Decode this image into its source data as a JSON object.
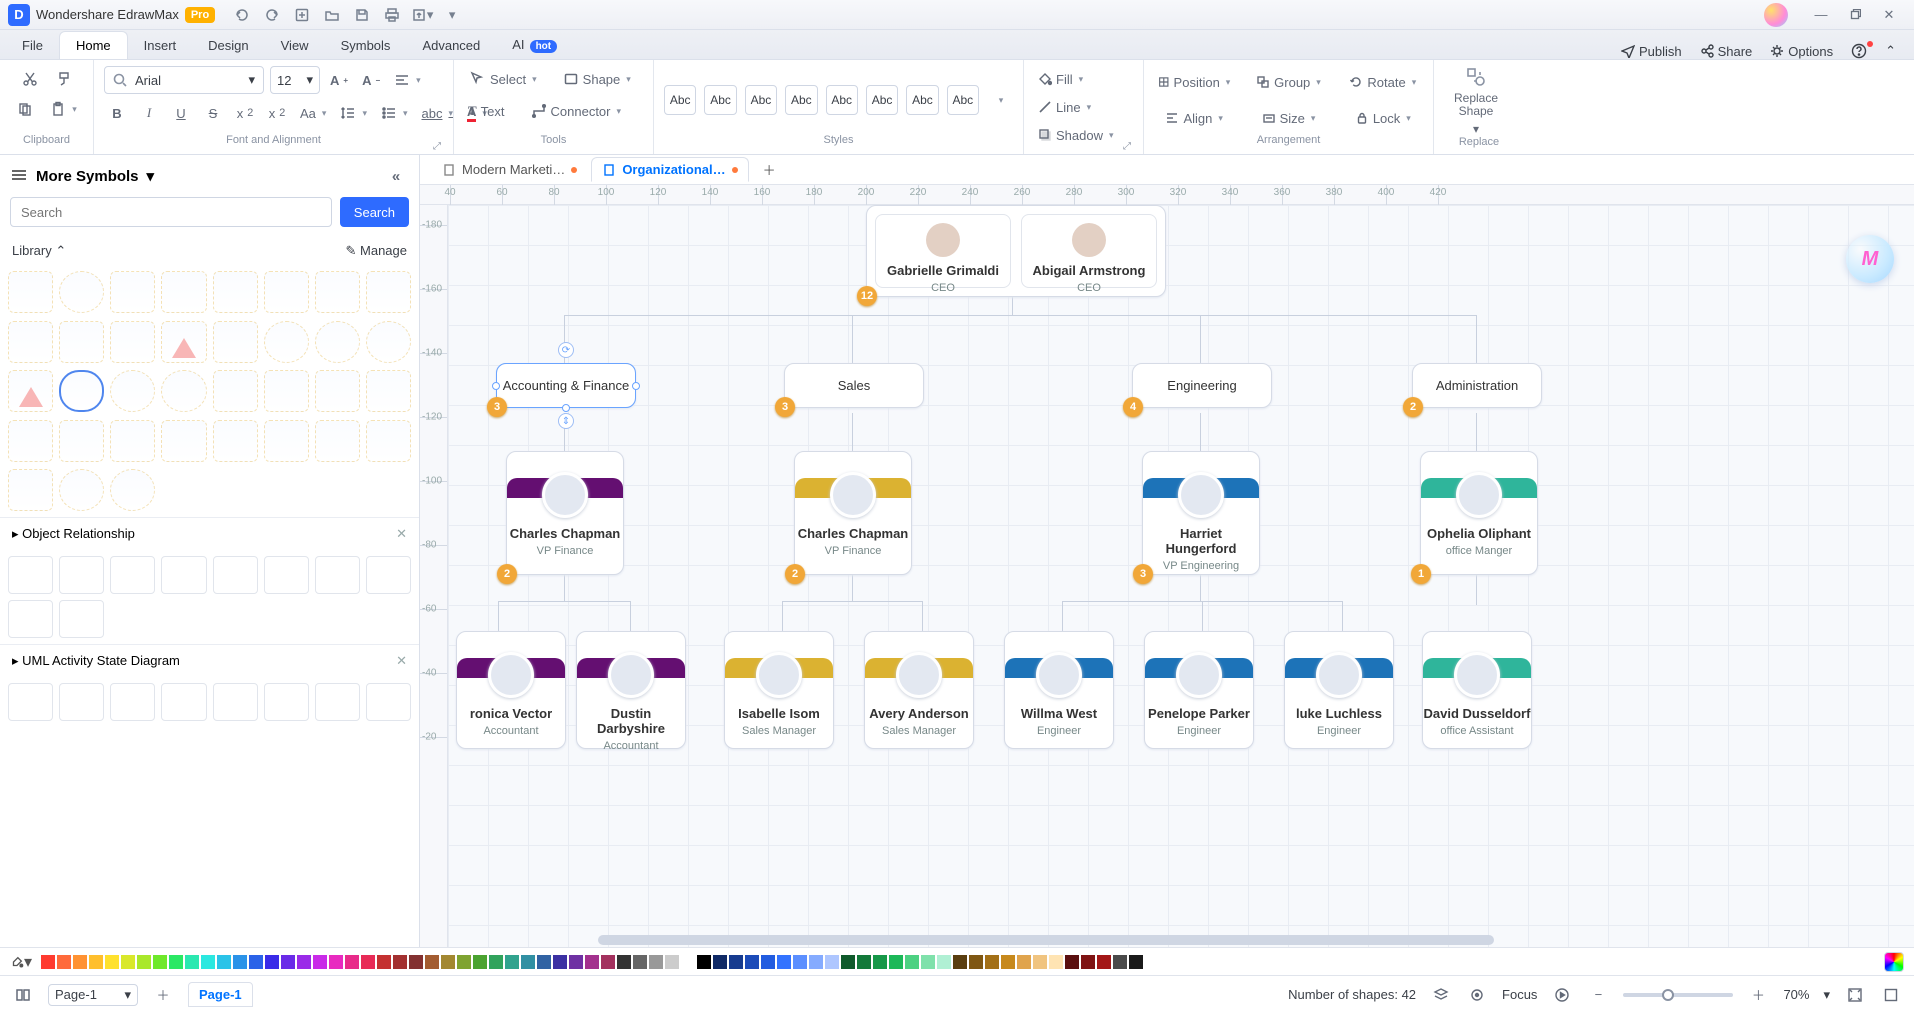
{
  "app": {
    "name": "Wondershare EdrawMax",
    "badge": "Pro"
  },
  "window_controls": {
    "minimize": "—",
    "maximize": "restore",
    "close": "×"
  },
  "menu": {
    "tabs": [
      "File",
      "Home",
      "Insert",
      "Design",
      "View",
      "Symbols",
      "Advanced",
      "AI"
    ],
    "active": 1,
    "ai_badge": "hot",
    "right": [
      "Publish",
      "Share",
      "Options"
    ]
  },
  "ribbon": {
    "clipboard": {
      "label": "Clipboard"
    },
    "font": {
      "label": "Font and Alignment",
      "font_name": "Arial",
      "font_size": "12",
      "buttons": [
        "A+",
        "A−",
        "align",
        "B",
        "I",
        "U",
        "S",
        "x²",
        "x₂",
        "Aa",
        "line-ht",
        "list",
        "abc",
        "A-color"
      ]
    },
    "tools": {
      "label": "Tools",
      "select": "Select",
      "text": "Text",
      "shape": "Shape",
      "connector": "Connector"
    },
    "styles": {
      "label": "Styles",
      "swatch_text": "Abc",
      "count": 8
    },
    "format": {
      "fill": "Fill",
      "line": "Line",
      "shadow": "Shadow"
    },
    "arrange": {
      "label": "Arrangement",
      "position": "Position",
      "group": "Group",
      "rotate": "Rotate",
      "align": "Align",
      "size": "Size",
      "lock": "Lock"
    },
    "replace": {
      "label": "Replace",
      "btn": "Replace Shape"
    }
  },
  "left_panel": {
    "header": "More Symbols",
    "search_placeholder": "Search",
    "search_btn": "Search",
    "library": "Library",
    "manage": "Manage",
    "categories": [
      "Object Relationship",
      "UML Activity State Diagram"
    ]
  },
  "doc_tabs": [
    {
      "label": "Modern Marketi…",
      "dirty": true,
      "active": false
    },
    {
      "label": "Organizational…",
      "dirty": true,
      "active": true
    }
  ],
  "ruler_h": [
    40,
    60,
    80,
    100,
    120,
    140,
    160,
    180,
    200,
    220,
    240,
    260,
    280,
    300,
    320,
    340,
    360,
    380,
    400,
    420
  ],
  "ruler_v": [
    -180,
    -160,
    -140,
    -120,
    -100,
    -80,
    -60,
    -40,
    -20
  ],
  "org": {
    "top_badge": "12",
    "ceos": [
      {
        "name": "Gabrielle Grimaldi",
        "title": "CEO"
      },
      {
        "name": "Abigail Armstrong",
        "title": "CEO"
      }
    ],
    "depts": [
      {
        "name": "Accounting & Finance",
        "badge": "3",
        "selected": true
      },
      {
        "name": "Sales",
        "badge": "3"
      },
      {
        "name": "Engineering",
        "badge": "4"
      },
      {
        "name": "Administration",
        "badge": "2"
      }
    ],
    "vps": [
      {
        "name": "Charles Chapman",
        "title": "VP Finance",
        "color": "purple",
        "badge": "2"
      },
      {
        "name": "Charles Chapman",
        "title": "VP Finance",
        "color": "yellow",
        "badge": "2"
      },
      {
        "name": "Harriet Hungerford",
        "title": "VP Engineering",
        "color": "blue",
        "badge": "3"
      },
      {
        "name": "Ophelia Oliphant",
        "title": "office Manger",
        "color": "teal",
        "badge": "1"
      }
    ],
    "leaves": [
      {
        "name": "ronica Vector",
        "title": "Accountant",
        "color": "purple"
      },
      {
        "name": "Dustin Darbyshire",
        "title": "Accountant",
        "color": "purple"
      },
      {
        "name": "Isabelle Isom",
        "title": "Sales Manager",
        "color": "yellow"
      },
      {
        "name": "Avery Anderson",
        "title": "Sales Manager",
        "color": "yellow"
      },
      {
        "name": "Willma West",
        "title": "Engineer",
        "color": "blue"
      },
      {
        "name": "Penelope Parker",
        "title": "Engineer",
        "color": "blue"
      },
      {
        "name": "luke Luchless",
        "title": "Engineer",
        "color": "blue"
      },
      {
        "name": "David Dusseldorf",
        "title": "office Assistant",
        "color": "teal"
      }
    ]
  },
  "colors": [
    "#ff3b30",
    "#ff6a3b",
    "#ff9233",
    "#ffbf2d",
    "#ffe12d",
    "#d9e82b",
    "#a9e82b",
    "#6fe82b",
    "#2be864",
    "#2be8b0",
    "#2be8e0",
    "#2bc3e8",
    "#2b93e8",
    "#2b63e8",
    "#3a2be8",
    "#6a2be8",
    "#9a2be8",
    "#c92be8",
    "#e82bc0",
    "#e82b8a",
    "#e82b57",
    "#c43131",
    "#a33131",
    "#833131",
    "#a35c31",
    "#a38831",
    "#7fa331",
    "#4ba331",
    "#31a35c",
    "#31a38e",
    "#3190a3",
    "#3163a3",
    "#3c31a3",
    "#6f31a3",
    "#a3318e",
    "#a3315e",
    "#333333",
    "#666666",
    "#999999",
    "#cccccc",
    "#ffffff",
    "#000000",
    "#102a66",
    "#163b8f",
    "#1c4bb8",
    "#225ce0",
    "#3373ff",
    "#5c8fff",
    "#85abff",
    "#aec6ff",
    "#0f5a2b",
    "#13793a",
    "#179849",
    "#1cb858",
    "#4dd182",
    "#7fe1ab",
    "#b0f0d4",
    "#5a3e0f",
    "#7f5713",
    "#a37017",
    "#c7891c",
    "#e0a44d",
    "#f0c480",
    "#ffe4b3",
    "#5a0f0f",
    "#7f1313",
    "#a31717",
    "#4a4a4a",
    "#1a1a1a"
  ],
  "status": {
    "page_selector": "Page-1",
    "page_tab": "Page-1",
    "shapes_label": "Number of shapes:",
    "shapes_count": 42,
    "focus": "Focus",
    "zoom": "70%"
  }
}
